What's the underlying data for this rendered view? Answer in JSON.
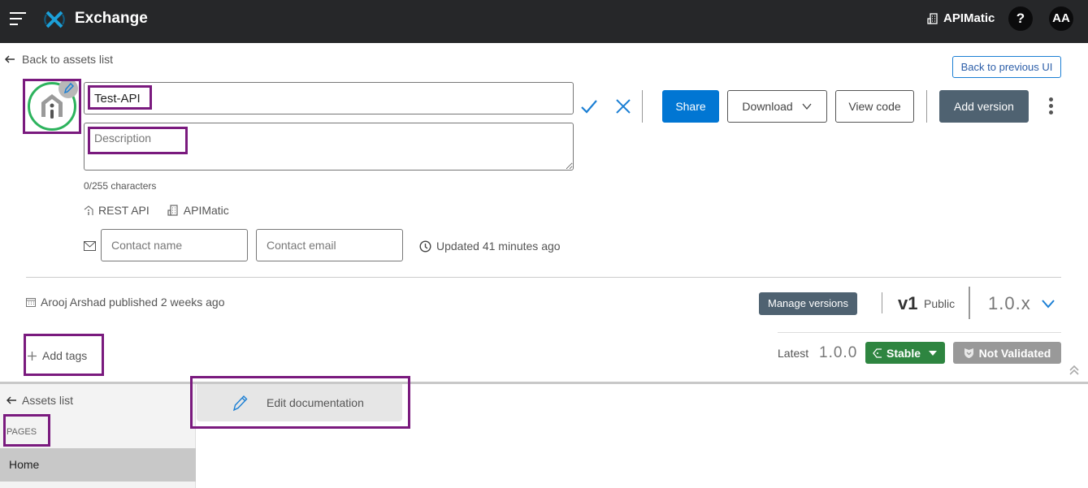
{
  "topbar": {
    "app_title": "Exchange",
    "org_name": "APIMatic",
    "help_label": "?",
    "avatar_initials": "AA",
    "brand_color": "#1ca0d8"
  },
  "header": {
    "back_link": "Back to assets list",
    "back_previous_ui": "Back to previous UI"
  },
  "asset": {
    "name_value": "Test-API",
    "description_placeholder": "Description",
    "description_value": "",
    "char_count": "0/255 characters",
    "type": "REST API",
    "organization": "APIMatic",
    "contact_name_placeholder": "Contact name",
    "contact_email_placeholder": "Contact email",
    "updated": "Updated 41 minutes ago",
    "published": "Arooj Arshad published 2 weeks ago",
    "add_tags": "Add tags"
  },
  "actions": {
    "share": "Share",
    "download": "Download",
    "view_code": "View code",
    "add_version": "Add version"
  },
  "versions": {
    "manage_versions": "Manage versions",
    "major": "v1",
    "visibility": "Public",
    "selected": "1.0.x",
    "latest_label": "Latest",
    "latest_version": "1.0.0",
    "lifecycle": "Stable",
    "validation": "Not Validated",
    "stable_color": "#2e8540"
  },
  "sidebar": {
    "assets_list": "Assets list",
    "section_label": "PAGES",
    "items": [
      {
        "label": "Home",
        "selected": true
      }
    ]
  },
  "docs": {
    "edit_documentation": "Edit documentation"
  }
}
